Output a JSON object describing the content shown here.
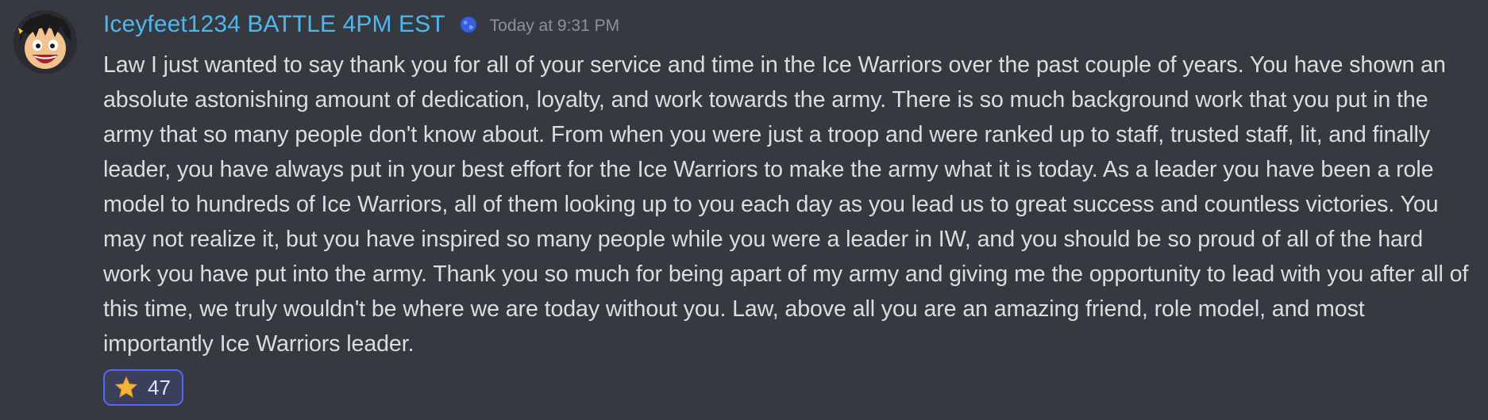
{
  "message": {
    "author": "Iceyfeet1234 BATTLE 4PM EST",
    "author_color": "#4fb7f0",
    "badge_icon": "globe-icon",
    "timestamp": "Today at 9:31 PM",
    "avatar": "cartoon-character-avatar",
    "text": "Law I just wanted to say thank you for all of your service and time in the Ice Warriors over the past couple of years. You have shown an absolute astonishing amount of dedication, loyalty, and work towards the army. There is so much background work that you put in the army that so many people don't know about. From when you were just a troop and were ranked up to staff, trusted staff, lit, and finally leader, you have always put in your best effort for the Ice Warriors to make the army what it is today. As a leader you have been a role model to hundreds of Ice Warriors, all of them looking up to you each day as you lead us to great success and countless victories. You may not realize it, but you have inspired so many people while you were a leader in IW, and you should be so proud of all of the hard work you have put into the army. Thank you so much for being apart of my army and giving me the opportunity to lead with you after all of this time, we truly wouldn't be where we are today without you. Law, above all you are an amazing friend, role model, and most importantly Ice Warriors leader.",
    "reactions": [
      {
        "emoji": "star-icon",
        "count": "47",
        "active": true
      }
    ]
  },
  "colors": {
    "background": "#36393f",
    "text": "#dcddde",
    "timestamp": "#8e9297",
    "reaction_border": "#5865f2",
    "reaction_bg": "#3b405a",
    "star": "#f4b43a"
  }
}
